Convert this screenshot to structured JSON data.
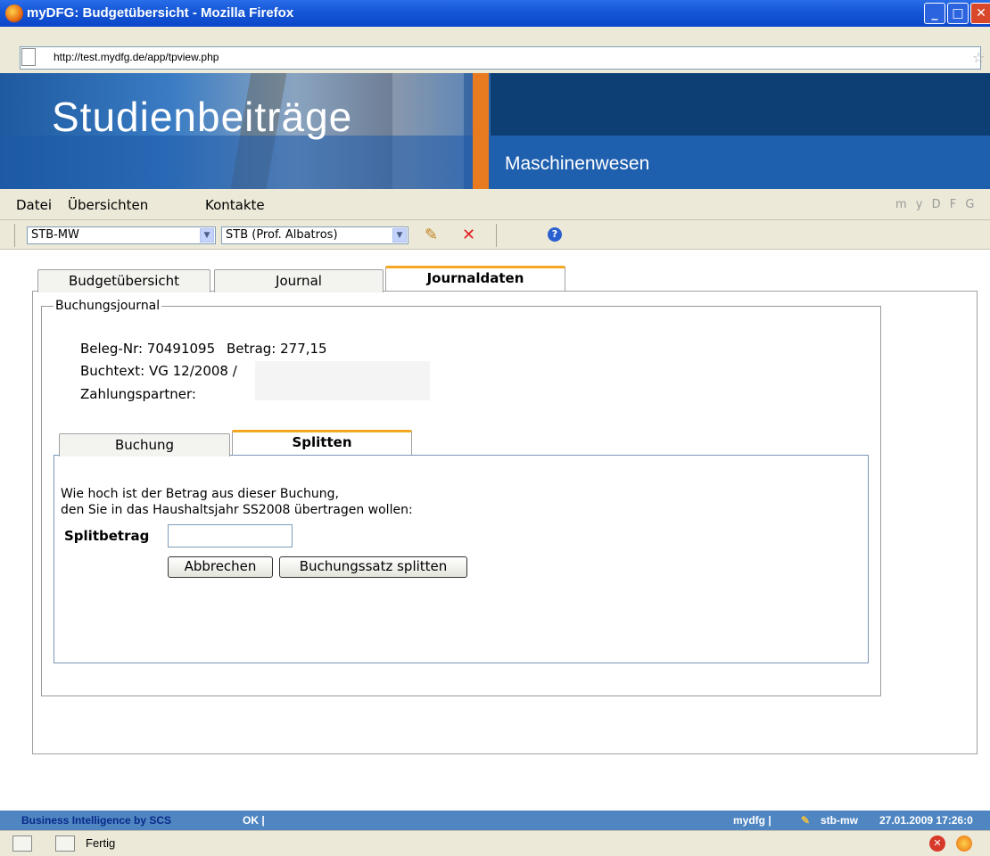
{
  "window": {
    "title": "myDFG: Budgetübersicht - Mozilla Firefox",
    "controls": [
      "_",
      "□",
      "✕"
    ]
  },
  "address": {
    "url": "http://test.mydfg.de/app/tpview.php"
  },
  "banner": {
    "title": "Studienbeiträge",
    "subtitle": "Maschinenwesen"
  },
  "menu": {
    "items": [
      "Datei",
      "Übersichten",
      "Kontakte"
    ],
    "brand": "m y D F G"
  },
  "toolbar": {
    "select1": {
      "value": "STB-MW"
    },
    "select2": {
      "value": "STB (Prof. Albatros)"
    },
    "icons": [
      "pencil-icon",
      "delete-icon",
      "help-icon"
    ]
  },
  "tabs": [
    {
      "label": "Budgetübersicht",
      "active": false
    },
    {
      "label": "Journal",
      "active": false
    },
    {
      "label": "Journaldaten",
      "active": true
    }
  ],
  "journal": {
    "legend": "Buchungsjournal",
    "beleg": "Beleg-Nr: 70491095",
    "betrag": "Betrag: 277,15",
    "buchtext": "Buchtext: VG 12/2008 /",
    "zahlungspartner": "Zahlungspartner:"
  },
  "subtabs": [
    {
      "label": "Buchung",
      "active": false
    },
    {
      "label": "Splitten",
      "active": true
    }
  ],
  "split": {
    "question_line1": "Wie hoch ist der Betrag aus dieser Buchung,",
    "question_line2": "den Sie in das Haushaltsjahr SS2008 übertragen wollen:",
    "field_label": "Splitbetrag",
    "field_value": "",
    "cancel_label": "Abbrechen",
    "submit_label": "Buchungssatz splitten"
  },
  "statusbar": {
    "left": "Business Intelligence by SCS",
    "ok": "OK |",
    "app": "mydfg |",
    "user": "stb-mw",
    "datetime": "27.01.2009 17:26:0"
  },
  "browser_status": {
    "text": "Fertig"
  },
  "colors": {
    "tab_accent": "#f5a623",
    "status_blue": "#4f86c2",
    "title_blue": "#1657d8"
  }
}
